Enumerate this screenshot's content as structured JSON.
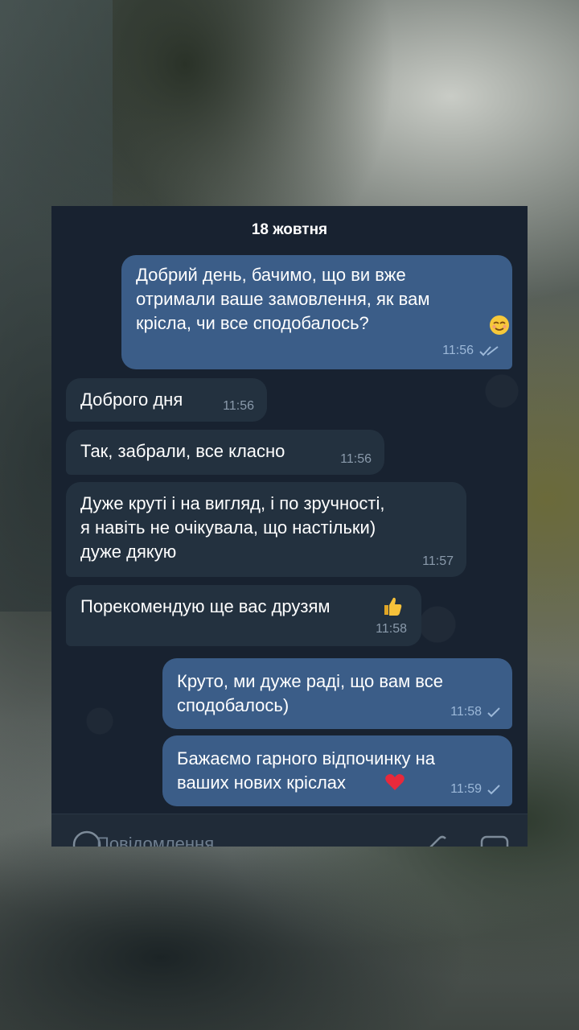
{
  "chat": {
    "date": "18 жовтня",
    "messages": [
      {
        "direction": "out",
        "text": "Добрий день, бачимо, що ви вже\nотримали ваше замовлення, як вам\nкрісла, чи все сподобалось?",
        "emoji": "relieved-face",
        "time": "11:56",
        "status": "read"
      },
      {
        "direction": "in",
        "text": "Доброго дня",
        "time": "11:56"
      },
      {
        "direction": "in",
        "text": "Так, забрали, все класно",
        "time": "11:56"
      },
      {
        "direction": "in",
        "text": "Дуже круті і на вигляд, і по зручності,\nя навіть не очікувала, що настільки)\nдуже дякую",
        "time": "11:57"
      },
      {
        "direction": "in",
        "text": "Порекомендую ще вас друзям",
        "emoji": "thumbs-up",
        "time": "11:58"
      },
      {
        "direction": "out",
        "text": "Круто, ми дуже раді, що вам все\nсподобалось)",
        "time": "11:58",
        "status": "sent"
      },
      {
        "direction": "out",
        "text": "Бажаємо гарного відпочинку на\nваших нових кріслах",
        "emoji": "red-heart",
        "time": "11:59",
        "status": "sent"
      }
    ],
    "input": {
      "placeholder": "Повідомлення"
    }
  },
  "colors": {
    "chat_bg": "#182230",
    "bubble_in": "#23313f",
    "bubble_out": "#3b5d88",
    "read_tick": "#9cb8d8"
  },
  "icons": [
    "emoji-icon",
    "attach-icon",
    "camera-icon",
    "double-check-icon",
    "check-icon"
  ]
}
